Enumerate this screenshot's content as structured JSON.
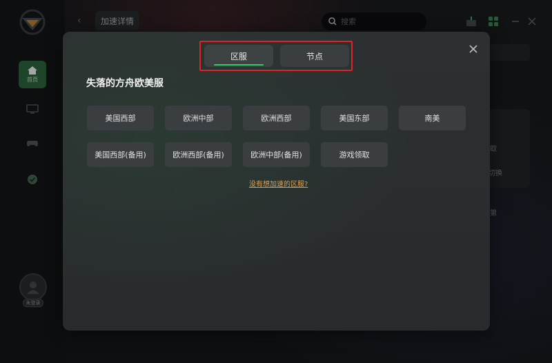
{
  "header": {
    "back_icon": "chevron-left-icon",
    "tab_label": "加速详情",
    "search_placeholder": "搜索"
  },
  "sidebar": {
    "items": [
      {
        "icon": "home-icon",
        "label": "首页",
        "active": true
      },
      {
        "icon": "monitor-icon",
        "label": ""
      },
      {
        "icon": "gamepad-icon",
        "label": ""
      },
      {
        "icon": "check-circle-icon",
        "label": ""
      }
    ],
    "avatar_badge": "未登录"
  },
  "background_text": {
    "line1": "取",
    "line2": "切换",
    "line3": "第"
  },
  "modal": {
    "tabs": [
      {
        "label": "区服",
        "active": true
      },
      {
        "label": "节点",
        "active": false
      }
    ],
    "game_title": "失落的方舟欧美服",
    "regions_row1": [
      "美国西部",
      "欧洲中部",
      "欧洲西部",
      "美国东部",
      "南美"
    ],
    "regions_row2": [
      "美国西部(备用)",
      "欧洲西部(备用)",
      "欧洲中部(备用)",
      "游戏领取"
    ],
    "no_region_link": "没有想加速的区服?"
  },
  "colors": {
    "accent_green": "#35c76a",
    "highlight_red": "#e02424",
    "link_orange": "#d9a053"
  }
}
